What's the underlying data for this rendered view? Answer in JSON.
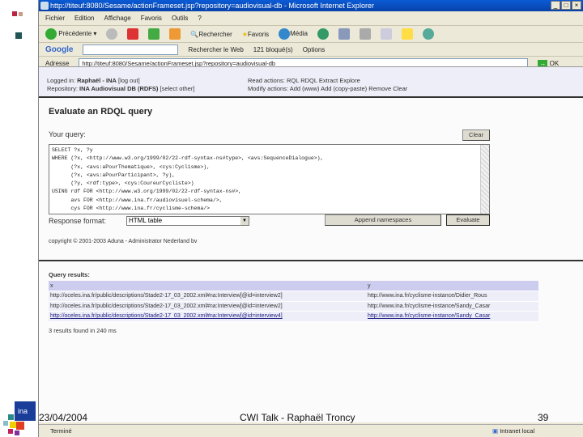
{
  "browser": {
    "title": "http://titeuf:8080/Sesame/actionFrameset.jsp?repository=audiovisual-db - Microsoft Internet Explorer",
    "menu": [
      "Fichier",
      "Edition",
      "Affichage",
      "Favoris",
      "Outils",
      "?"
    ],
    "toolbar": {
      "back": "Précédente",
      "search": "Rechercher",
      "favorites": "Favoris",
      "media": "Média"
    },
    "google": {
      "label": "Google",
      "search_web": "Rechercher le Web",
      "blocked": "121 bloqué(s)",
      "options": "Options"
    },
    "address": {
      "label": "Adresse",
      "url": "http://titeuf:8080/Sesame/actionFrameset.jsp?repository=audiovisual-db",
      "go": "OK"
    },
    "status": {
      "text": "Terminé",
      "zone": "Intranet local"
    }
  },
  "header": {
    "logged_label": "Logged in:",
    "user": "Raphaël - INA",
    "logout": "[log out]",
    "repo_label": "Repository:",
    "repo": "INA Audiovisual DB (RDFS)",
    "select_other": "[select other]",
    "read_label": "Read actions:",
    "read_actions": [
      "RQL",
      "RDQL",
      "Extract",
      "Explore"
    ],
    "modify_label": "Modify actions:",
    "modify_actions": [
      "Add (www)",
      "Add (copy-paste)",
      "Remove",
      "Clear"
    ]
  },
  "form": {
    "title": "Evaluate an RDQL query",
    "query_label": "Your query:",
    "clear": "Clear",
    "query": "SELECT ?x, ?y\nWHERE (?x, <http://www.w3.org/1999/02/22-rdf-syntax-ns#type>, <avs:SequenceDialogue>),\n      (?x, <avs:aPourThematique>, <cys:Cyclisme>),\n      (?x, <avs:aPourParticipant>, ?y),\n      (?y, <rdf:type>, <cys:CoureurCycliste>)\nUSING rdf FOR <http://www.w3.org/1999/02/22-rdf-syntax-ns#>,\n      avs FOR <http://www.ina.fr/audiovisuel-schema/>,\n      cys FOR <http://www.ina.fr/cyclisme-schema/>",
    "format_label": "Response format:",
    "format_value": "HTML table",
    "append": "Append namespaces",
    "evaluate": "Evaluate",
    "copyright": "copyright © 2001-2003 Aduna - Administrator Nederland bv"
  },
  "results": {
    "title": "Query results:",
    "columns": [
      "x",
      "y"
    ],
    "rows": [
      [
        "http://oceles.ina.fr/public/descriptions/Stade2-17_03_2002.xml#na:Interview[@id=interview2]",
        "http://www.ina.fr/cyclisme-instance/Didier_Rous"
      ],
      [
        "http://oceles.ina.fr/public/descriptions/Stade2-17_03_2002.xml#na:Interview[@id=interview2]",
        "http://www.ina.fr/cyclisme-instance/Sandy_Casar"
      ],
      [
        "http://oceles.ina.fr/public/descriptions/Stade2-17_03_2002.xml#na:Interview[@id=interview4]",
        "http://www.ina.fr/cyclisme-instance/Sandy_Casar"
      ]
    ],
    "summary": "3 results found in 240 ms"
  },
  "slide": {
    "date": "23/04/2004",
    "title": "CWI Talk - Raphaël Troncy",
    "page": "39",
    "logo": "ina"
  }
}
